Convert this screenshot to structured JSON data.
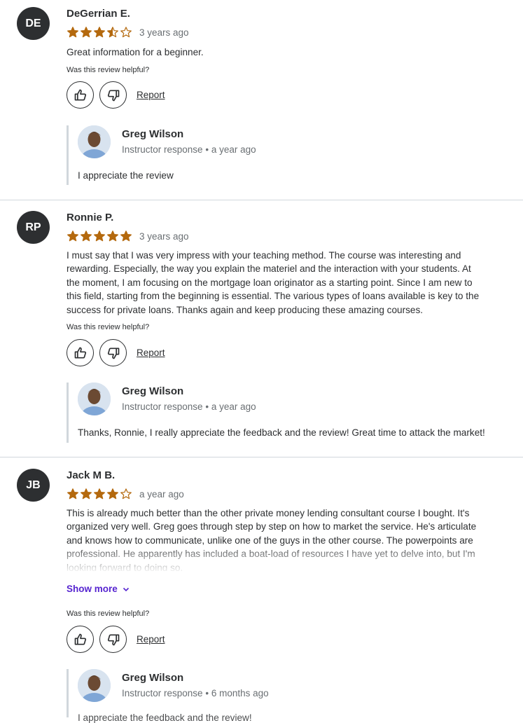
{
  "colors": {
    "star": "#b4690e",
    "accent": "#5624d0",
    "text": "#2d2f31",
    "muted": "#6a6f73",
    "border": "#d1d7dc"
  },
  "helpful_label": "Was this review helpful?",
  "report_label": "Report",
  "reviews": [
    {
      "initials": "DE",
      "name": "DeGerrian E.",
      "rating": 3.5,
      "date": "3 years ago",
      "text": "Great information for a beginner.",
      "response": {
        "name": "Greg Wilson",
        "role": "Instructor response",
        "separator": "•",
        "date": "a year ago",
        "text": "I appreciate the review"
      }
    },
    {
      "initials": "RP",
      "name": "Ronnie P.",
      "rating": 5,
      "date": "3 years ago",
      "text": "I must say that I was very impress with your teaching method. The course was interesting and rewarding. Especially, the way you explain the materiel and the interaction with your students. At the moment, I am focusing on the mortgage loan originator as a starting point. Since I am new to this field, starting from the beginning is essential. The various types of loans available is key to the success for private loans. Thanks again and keep producing these amazing courses.",
      "response": {
        "name": "Greg Wilson",
        "role": "Instructor response",
        "separator": "•",
        "date": "a year ago",
        "text": "Thanks, Ronnie, I really appreciate the feedback and the review! Great time to attack the market!"
      }
    },
    {
      "initials": "JB",
      "name": "Jack M B.",
      "rating": 4,
      "date": "a year ago",
      "text": "This is already much better than the other private money lending consultant course I bought. It's organized very well. Greg goes through step by step on how to market the service. He's articulate and knows how to communicate, unlike one of the guys in the other course. The powerpoints are professional. He apparently has included a boat-load of resources I have yet to delve into, but I'm looking forward to doing so.",
      "show_more": "Show more",
      "response": {
        "name": "Greg Wilson",
        "role": "Instructor response",
        "separator": "•",
        "date": "6 months ago",
        "text": "I appreciate the feedback and the review!"
      }
    }
  ]
}
